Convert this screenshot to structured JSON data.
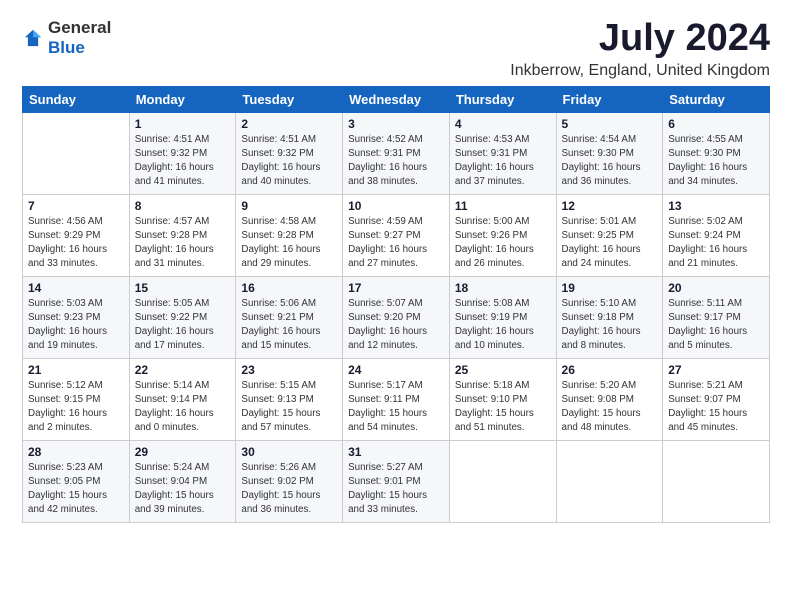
{
  "logo": {
    "text_general": "General",
    "text_blue": "Blue"
  },
  "header": {
    "month_year": "July 2024",
    "location": "Inkberrow, England, United Kingdom"
  },
  "days_of_week": [
    "Sunday",
    "Monday",
    "Tuesday",
    "Wednesday",
    "Thursday",
    "Friday",
    "Saturday"
  ],
  "weeks": [
    [
      {
        "day": "",
        "info": ""
      },
      {
        "day": "1",
        "info": "Sunrise: 4:51 AM\nSunset: 9:32 PM\nDaylight: 16 hours\nand 41 minutes."
      },
      {
        "day": "2",
        "info": "Sunrise: 4:51 AM\nSunset: 9:32 PM\nDaylight: 16 hours\nand 40 minutes."
      },
      {
        "day": "3",
        "info": "Sunrise: 4:52 AM\nSunset: 9:31 PM\nDaylight: 16 hours\nand 38 minutes."
      },
      {
        "day": "4",
        "info": "Sunrise: 4:53 AM\nSunset: 9:31 PM\nDaylight: 16 hours\nand 37 minutes."
      },
      {
        "day": "5",
        "info": "Sunrise: 4:54 AM\nSunset: 9:30 PM\nDaylight: 16 hours\nand 36 minutes."
      },
      {
        "day": "6",
        "info": "Sunrise: 4:55 AM\nSunset: 9:30 PM\nDaylight: 16 hours\nand 34 minutes."
      }
    ],
    [
      {
        "day": "7",
        "info": "Sunrise: 4:56 AM\nSunset: 9:29 PM\nDaylight: 16 hours\nand 33 minutes."
      },
      {
        "day": "8",
        "info": "Sunrise: 4:57 AM\nSunset: 9:28 PM\nDaylight: 16 hours\nand 31 minutes."
      },
      {
        "day": "9",
        "info": "Sunrise: 4:58 AM\nSunset: 9:28 PM\nDaylight: 16 hours\nand 29 minutes."
      },
      {
        "day": "10",
        "info": "Sunrise: 4:59 AM\nSunset: 9:27 PM\nDaylight: 16 hours\nand 27 minutes."
      },
      {
        "day": "11",
        "info": "Sunrise: 5:00 AM\nSunset: 9:26 PM\nDaylight: 16 hours\nand 26 minutes."
      },
      {
        "day": "12",
        "info": "Sunrise: 5:01 AM\nSunset: 9:25 PM\nDaylight: 16 hours\nand 24 minutes."
      },
      {
        "day": "13",
        "info": "Sunrise: 5:02 AM\nSunset: 9:24 PM\nDaylight: 16 hours\nand 21 minutes."
      }
    ],
    [
      {
        "day": "14",
        "info": "Sunrise: 5:03 AM\nSunset: 9:23 PM\nDaylight: 16 hours\nand 19 minutes."
      },
      {
        "day": "15",
        "info": "Sunrise: 5:05 AM\nSunset: 9:22 PM\nDaylight: 16 hours\nand 17 minutes."
      },
      {
        "day": "16",
        "info": "Sunrise: 5:06 AM\nSunset: 9:21 PM\nDaylight: 16 hours\nand 15 minutes."
      },
      {
        "day": "17",
        "info": "Sunrise: 5:07 AM\nSunset: 9:20 PM\nDaylight: 16 hours\nand 12 minutes."
      },
      {
        "day": "18",
        "info": "Sunrise: 5:08 AM\nSunset: 9:19 PM\nDaylight: 16 hours\nand 10 minutes."
      },
      {
        "day": "19",
        "info": "Sunrise: 5:10 AM\nSunset: 9:18 PM\nDaylight: 16 hours\nand 8 minutes."
      },
      {
        "day": "20",
        "info": "Sunrise: 5:11 AM\nSunset: 9:17 PM\nDaylight: 16 hours\nand 5 minutes."
      }
    ],
    [
      {
        "day": "21",
        "info": "Sunrise: 5:12 AM\nSunset: 9:15 PM\nDaylight: 16 hours\nand 2 minutes."
      },
      {
        "day": "22",
        "info": "Sunrise: 5:14 AM\nSunset: 9:14 PM\nDaylight: 16 hours\nand 0 minutes."
      },
      {
        "day": "23",
        "info": "Sunrise: 5:15 AM\nSunset: 9:13 PM\nDaylight: 15 hours\nand 57 minutes."
      },
      {
        "day": "24",
        "info": "Sunrise: 5:17 AM\nSunset: 9:11 PM\nDaylight: 15 hours\nand 54 minutes."
      },
      {
        "day": "25",
        "info": "Sunrise: 5:18 AM\nSunset: 9:10 PM\nDaylight: 15 hours\nand 51 minutes."
      },
      {
        "day": "26",
        "info": "Sunrise: 5:20 AM\nSunset: 9:08 PM\nDaylight: 15 hours\nand 48 minutes."
      },
      {
        "day": "27",
        "info": "Sunrise: 5:21 AM\nSunset: 9:07 PM\nDaylight: 15 hours\nand 45 minutes."
      }
    ],
    [
      {
        "day": "28",
        "info": "Sunrise: 5:23 AM\nSunset: 9:05 PM\nDaylight: 15 hours\nand 42 minutes."
      },
      {
        "day": "29",
        "info": "Sunrise: 5:24 AM\nSunset: 9:04 PM\nDaylight: 15 hours\nand 39 minutes."
      },
      {
        "day": "30",
        "info": "Sunrise: 5:26 AM\nSunset: 9:02 PM\nDaylight: 15 hours\nand 36 minutes."
      },
      {
        "day": "31",
        "info": "Sunrise: 5:27 AM\nSunset: 9:01 PM\nDaylight: 15 hours\nand 33 minutes."
      },
      {
        "day": "",
        "info": ""
      },
      {
        "day": "",
        "info": ""
      },
      {
        "day": "",
        "info": ""
      }
    ]
  ]
}
